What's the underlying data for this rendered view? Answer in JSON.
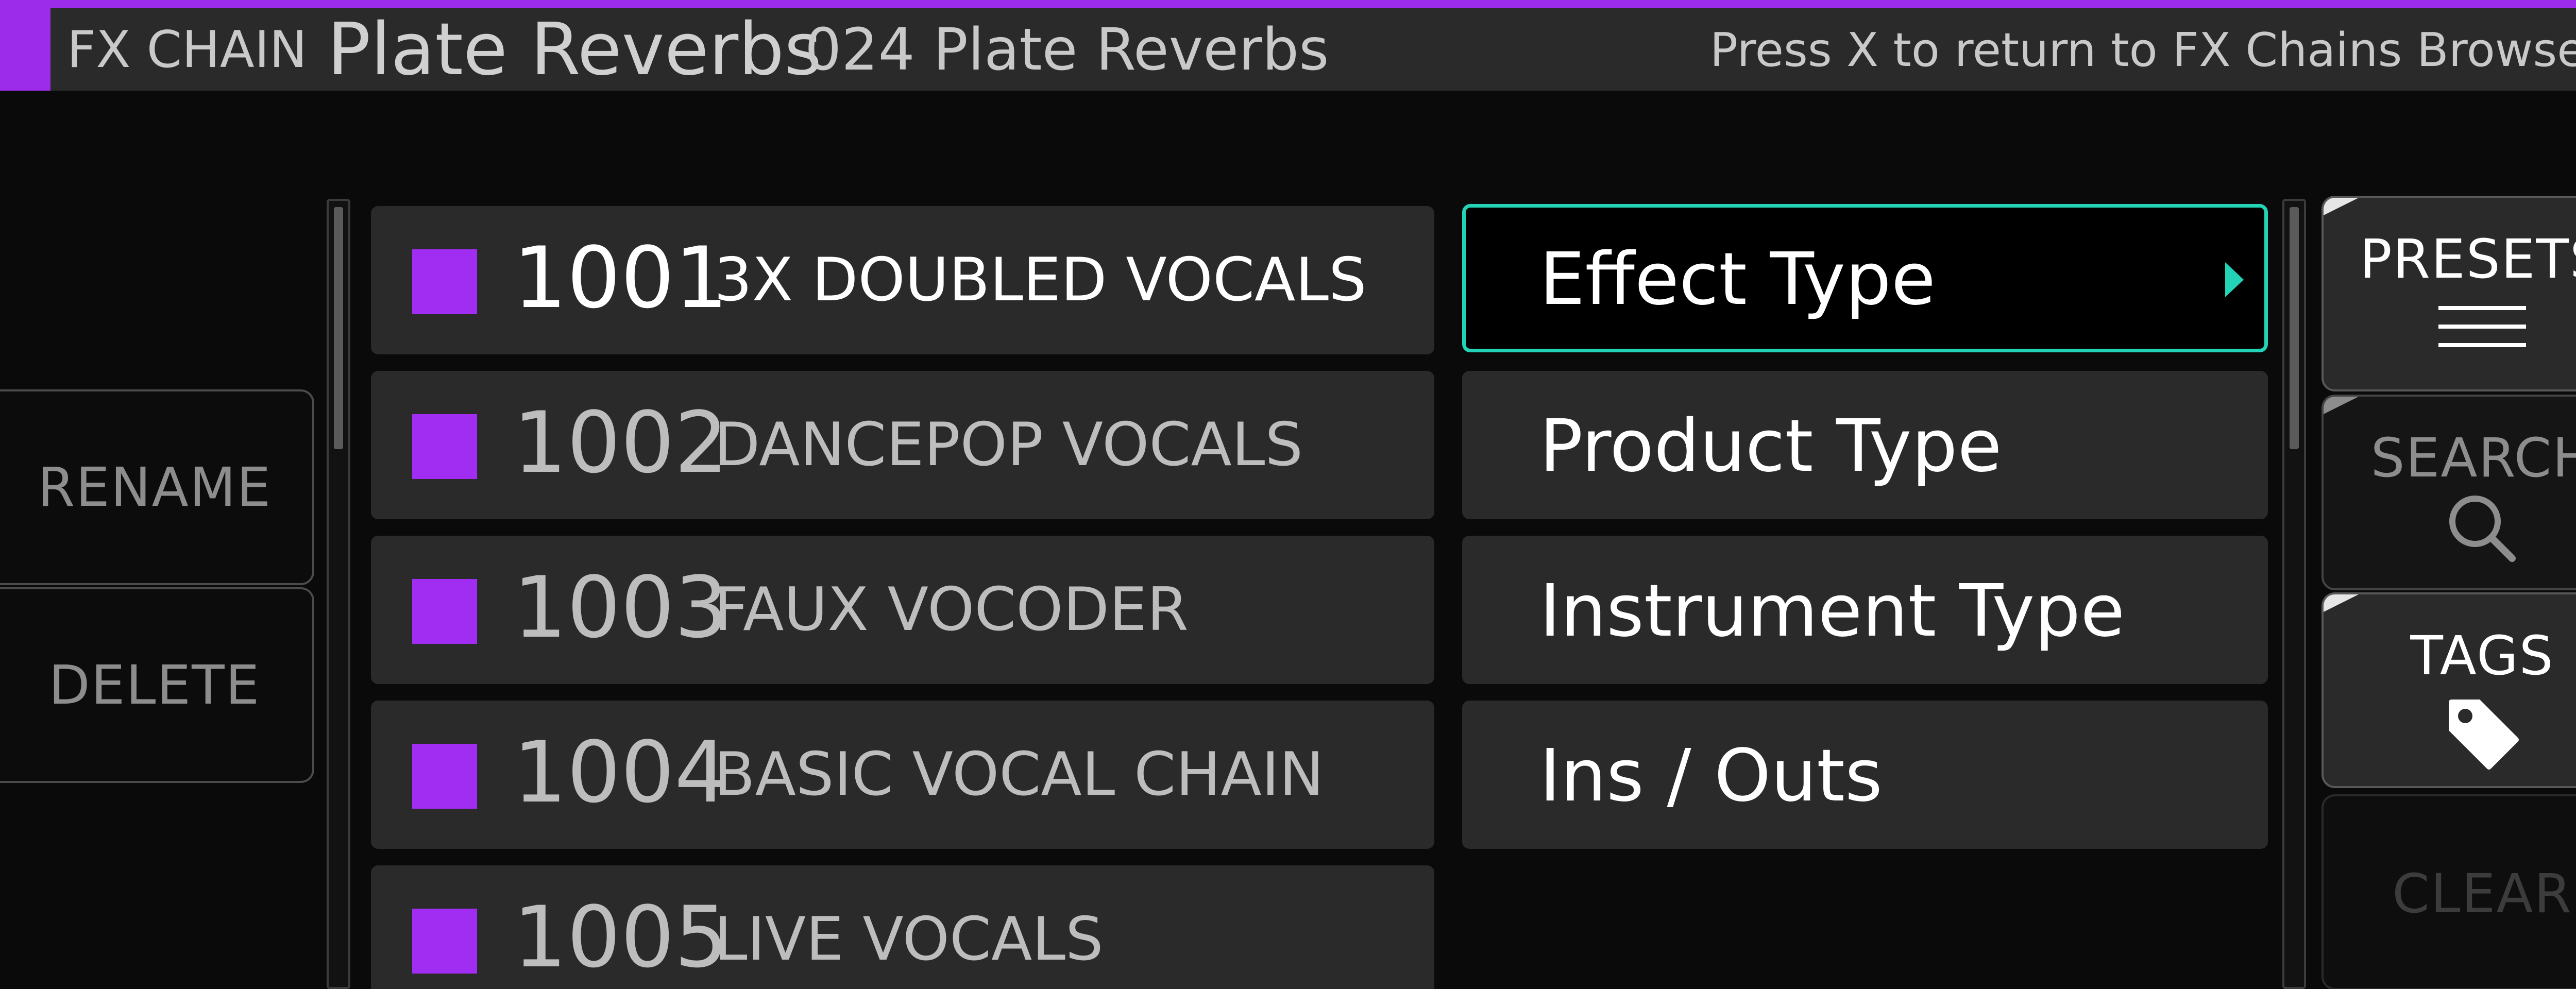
{
  "header": {
    "section_label": "FX CHAIN",
    "title": "Plate Reverbs",
    "subtitle": "024 Plate Reverbs",
    "hint": "Press X to return to FX Chains Browser."
  },
  "left_actions": {
    "rename_label": "RENAME",
    "delete_label": "DELETE"
  },
  "presets": [
    {
      "number": "1001",
      "name": "3X DOUBLED VOCALS",
      "selected": true
    },
    {
      "number": "1002",
      "name": "DANCEPOP VOCALS",
      "selected": false
    },
    {
      "number": "1003",
      "name": "FAUX VOCODER",
      "selected": false
    },
    {
      "number": "1004",
      "name": "BASIC VOCAL CHAIN",
      "selected": false
    },
    {
      "number": "1005",
      "name": "LIVE VOCALS",
      "selected": false
    }
  ],
  "tag_categories": [
    {
      "label": "Effect Type",
      "selected": true
    },
    {
      "label": "Product Type",
      "selected": false
    },
    {
      "label": "Instrument Type",
      "selected": false
    },
    {
      "label": "Ins / Outs",
      "selected": false
    }
  ],
  "right_tabs": {
    "presets_label": "PRESETS",
    "search_label": "SEARCH",
    "tags_label": "TAGS",
    "clear_label": "CLEAR",
    "presets_icon": "list-icon",
    "search_icon": "magnifier-icon",
    "tags_icon": "tag-icon"
  },
  "colors": {
    "accent": "#9d2bea",
    "selection": "#22d3b5",
    "preset_color": "#a12df2"
  }
}
